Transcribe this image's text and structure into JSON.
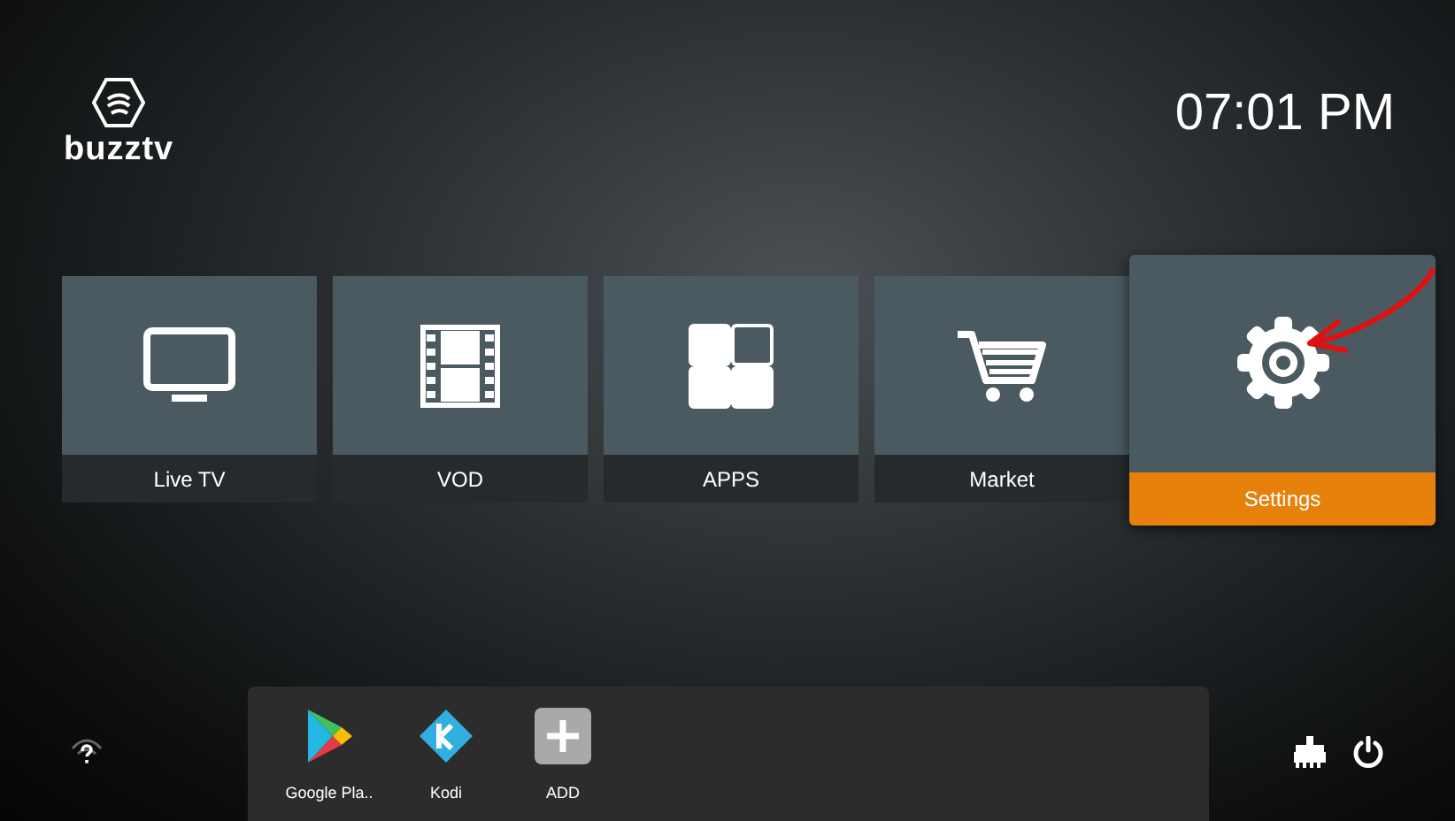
{
  "header": {
    "brand": "buzztv",
    "time": "07:01 PM"
  },
  "tiles": [
    {
      "kind": "tv",
      "label": "Live TV",
      "selected": false
    },
    {
      "kind": "film",
      "label": "VOD",
      "selected": false
    },
    {
      "kind": "apps",
      "label": "APPS",
      "selected": false
    },
    {
      "kind": "cart",
      "label": "Market",
      "selected": false
    },
    {
      "kind": "gear",
      "label": "Settings",
      "selected": true
    }
  ],
  "dock": [
    {
      "kind": "play",
      "label": "Google Pla.."
    },
    {
      "kind": "kodi",
      "label": "Kodi"
    },
    {
      "kind": "add",
      "label": "ADD"
    }
  ]
}
